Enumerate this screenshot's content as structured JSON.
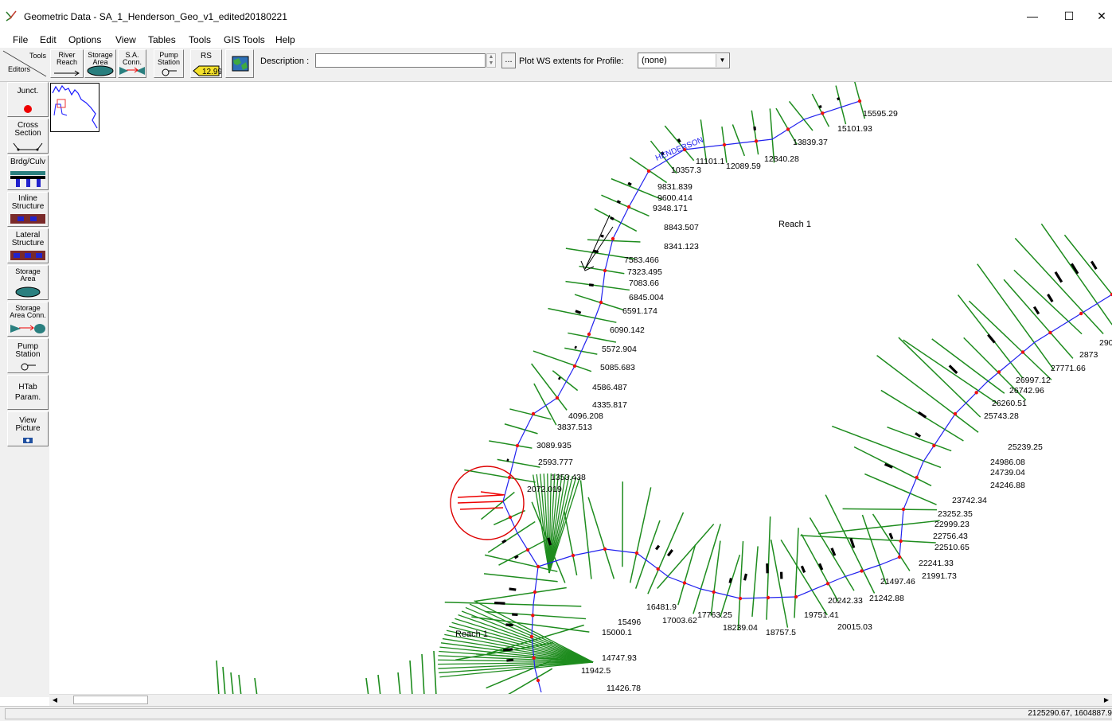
{
  "window": {
    "title": "Geometric Data - SA_1_Henderson_Geo_v1_edited20180221",
    "controls": {
      "minimize": "—",
      "maximize": "☐",
      "close": "✕"
    }
  },
  "menu": [
    "File",
    "Edit",
    "Options",
    "View",
    "Tables",
    "Tools",
    "GIS Tools",
    "Help"
  ],
  "toolbar": {
    "tools_label": "Tools",
    "editors_label": "Editors",
    "river_reach": "River Reach",
    "storage_area": "Storage Area",
    "sa_conn": "S.A. Conn.",
    "pump_station": "Pump Station",
    "rs": "RS",
    "rs_value": "12.99",
    "description_label": "Description :",
    "description_value": "",
    "ellipsis": "...",
    "plot_ws_label": "Plot WS extents for Profile:",
    "profile_value": "(none)"
  },
  "left_toolbar": {
    "junct": "Junct.",
    "cross_section": "Cross\nSection",
    "brdg_culv": "Brdg/Culv",
    "inline_structure": "Inline\nStructure",
    "lateral_structure": "Lateral\nStructure",
    "storage_area": "Storage\nArea",
    "storage_area_conn": "Storage\nArea Conn.",
    "pump_station": "Pump\nStation",
    "htab_param": "HTab\nParam.",
    "view_picture": "View\nPicture"
  },
  "map": {
    "river_name_label": "HENDERSON",
    "reach_labels": [
      "Reach 1",
      "Reach 1"
    ],
    "stations_upper": [
      "15595.29",
      "15101.93",
      "13839.37",
      "12840.28",
      "12089.59",
      "11101.1",
      "10357.3",
      "9831.839",
      "9600.414",
      "9348.171",
      "8843.507",
      "8341.123",
      "7583.466",
      "7323.495",
      "7083.66",
      "6845.004",
      "6591.174",
      "6090.142",
      "5572.904",
      "5085.683",
      "4586.487",
      "4335.817",
      "4096.208",
      "3837.513",
      "3089.935",
      "2593.777",
      "2072.019",
      "1353.438"
    ],
    "stations_lower": [
      "15496",
      "15000.1",
      "14747.93",
      "11942.5",
      "11426.78",
      "16481.9",
      "17003.62",
      "17763.25",
      "18239.04",
      "18757.5",
      "19751.41",
      "20015.03",
      "20242.33",
      "21242.88",
      "21497.46",
      "21991.73",
      "22241.33",
      "22510.65",
      "22756.43",
      "22999.23",
      "23252.35",
      "23742.34",
      "24246.88",
      "24739.04",
      "24986.08",
      "25239.25",
      "25743.28",
      "26260.51",
      "26742.96",
      "26997.12",
      "27771.66",
      "2873",
      "290"
    ]
  },
  "colors": {
    "xs_line": "#1e8c1e",
    "river": "#2222ee",
    "node": "#ee1111",
    "circle": "#dd0000"
  },
  "status": {
    "coordinates": "2125290.67, 1604887.9"
  }
}
